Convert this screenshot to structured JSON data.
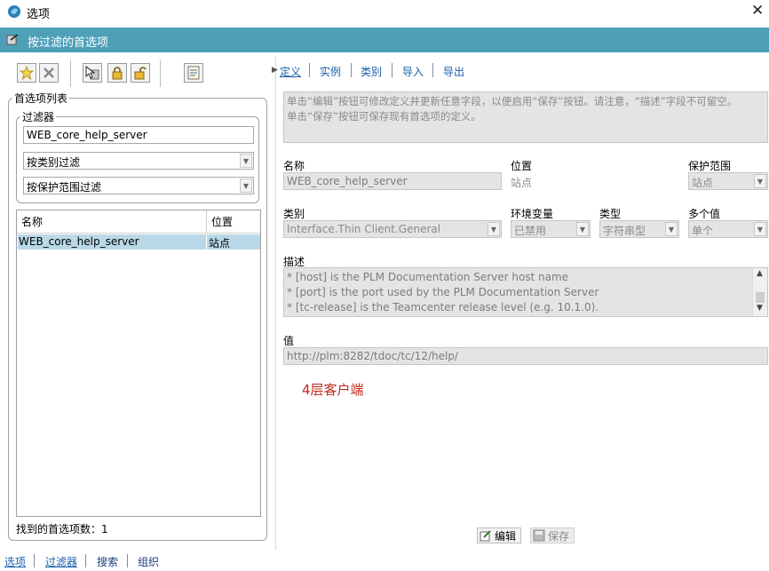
{
  "window": {
    "title": "选项",
    "app_icon": "teamcenter-icon"
  },
  "header": {
    "title": "按过滤的首选项",
    "icon": "filter-settings-icon"
  },
  "toolbar": {
    "buttons": [
      {
        "name": "new-icon"
      },
      {
        "name": "delete-icon"
      },
      {
        "name": "cursor-import-icon"
      },
      {
        "name": "lock-icon"
      },
      {
        "name": "unlock-icon"
      },
      {
        "name": "report-icon"
      }
    ]
  },
  "pref_list": {
    "group_label": "首选项列表",
    "filter_group_label": "过滤器",
    "filter_value": "WEB_core_help_server",
    "category_filter": "按类别过滤",
    "scope_filter": "按保护范围过滤",
    "columns": [
      "名称",
      "位置"
    ],
    "rows": [
      {
        "name": "WEB_core_help_server",
        "location": "站点"
      }
    ],
    "found_label": "找到的首选项数：1"
  },
  "footer_tabs": [
    "选项",
    "过滤器",
    "搜索",
    "组织"
  ],
  "detail": {
    "tabs": [
      "定义",
      "实例",
      "类别",
      "导入",
      "导出"
    ],
    "info_text_line1": "单击“编辑”按钮可修改定义并更新任意字段，以便启用“保存”按钮。请注意，“描述”字段不可留空。",
    "info_text_line2": "单击“保存”按钮可保存现有首选项的定义。",
    "name_label": "名称",
    "name_value": "WEB_core_help_server",
    "location_label": "位置",
    "location_value": "站点",
    "protection_label": "保护范围",
    "protection_value": "站点",
    "category_label": "类别",
    "category_value": "Interface.Thin Client.General",
    "envvar_label": "环境变量",
    "envvar_value": "已禁用",
    "type_label": "类型",
    "type_value": "字符串型",
    "multi_label": "多个值",
    "multi_value": "单个",
    "desc_label": "描述",
    "desc_lines": [
      "* [host] is the PLM Documentation Server host name",
      "* [port] is the port used by the PLM Documentation Server",
      "* [tc-release] is the Teamcenter release level (e.g. 10.1.0)."
    ],
    "value_label": "值",
    "value_value": "http://plm:8282/tdoc/tc/12/help/",
    "annotation": "4层客户端",
    "edit_label": "编辑",
    "save_label": "保存"
  },
  "colors": {
    "header": "#4e9fb8",
    "selection": "#b9d9e8",
    "link": "#1a5fa8",
    "annotation": "#c0281b"
  }
}
